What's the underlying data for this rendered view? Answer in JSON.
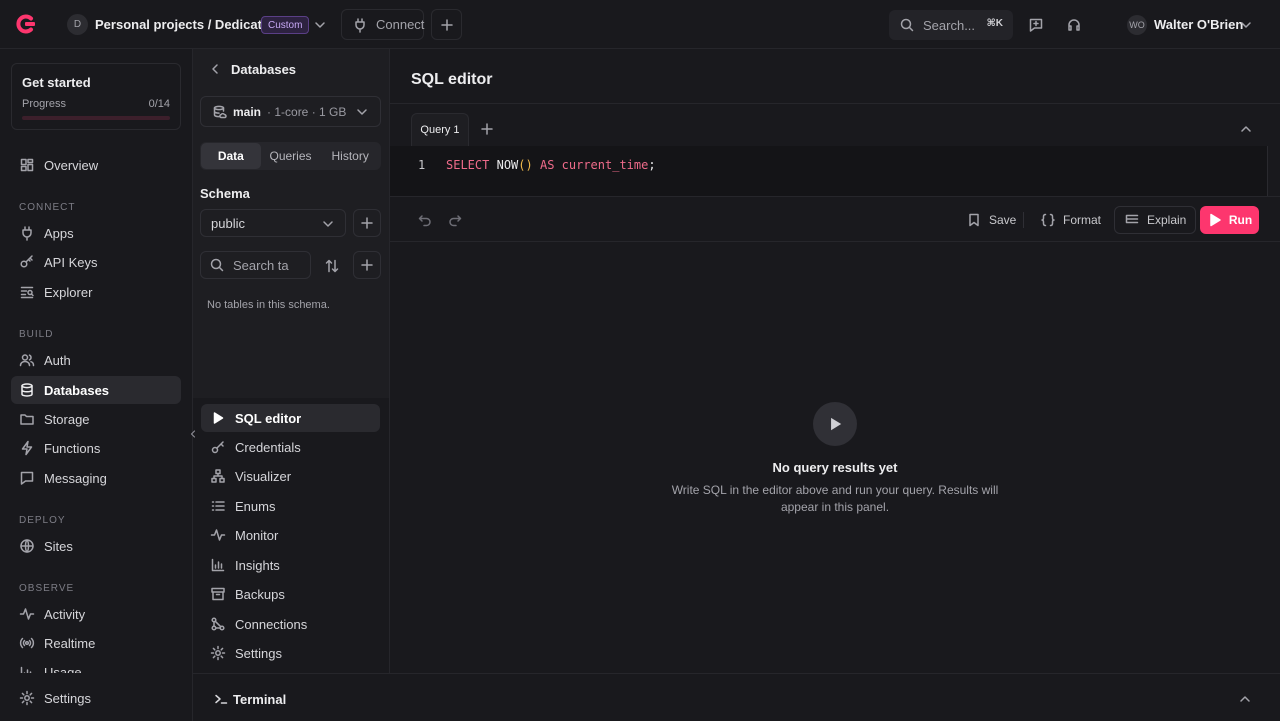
{
  "topbar": {
    "org_initial": "D",
    "org_path": "Personal projects / Dedicated",
    "plan_badge": "Custom",
    "connect_label": "Connect",
    "search_placeholder": "Search...",
    "search_shortcut": "⌘K",
    "user_initials": "WO",
    "user_name": "Walter O'Brien"
  },
  "get_started": {
    "title": "Get started",
    "progress_label": "Progress",
    "progress_value": "0/14",
    "progress_fraction": 0
  },
  "nav": {
    "overview": "Overview",
    "sections": {
      "connect": "CONNECT",
      "build": "BUILD",
      "deploy": "DEPLOY",
      "observe": "OBSERVE"
    },
    "connect_items": [
      "Apps",
      "API Keys",
      "Explorer"
    ],
    "build_items": [
      "Auth",
      "Databases",
      "Storage",
      "Functions",
      "Messaging"
    ],
    "deploy_items": [
      "Sites"
    ],
    "observe_items": [
      "Activity",
      "Realtime",
      "Usage"
    ],
    "settings": "Settings",
    "active": "Databases"
  },
  "database_panel": {
    "back_title": "Databases",
    "db_name": "main",
    "db_meta": "· 1-core · 1 GB",
    "tabs": [
      "Data",
      "Queries",
      "History"
    ],
    "active_tab": "Data",
    "schema_label": "Schema",
    "schema_value": "public",
    "table_search_placeholder": "Search ta",
    "empty_message": "No tables in this schema.",
    "tools": [
      "SQL editor",
      "Credentials",
      "Visualizer",
      "Enums",
      "Monitor",
      "Insights",
      "Backups",
      "Connections",
      "Settings"
    ],
    "active_tool": "SQL editor"
  },
  "editor": {
    "title": "SQL editor",
    "query_tab": "Query 1",
    "line_number": "1",
    "code": {
      "kw1": "SELECT",
      "fn": "NOW",
      "parens": "()",
      "kw2": "AS",
      "alias": "current_time",
      "end": ";"
    },
    "toolbar": {
      "save": "Save",
      "format": "Format",
      "explain": "Explain",
      "run": "Run"
    },
    "empty_title": "No query results yet",
    "empty_description": "Write SQL in the editor above and run your query. Results will appear in this panel."
  },
  "terminal": {
    "label": "Terminal"
  },
  "colors": {
    "accent": "#fd366e",
    "background": "#19191d",
    "badge": "#c7a8f5"
  }
}
